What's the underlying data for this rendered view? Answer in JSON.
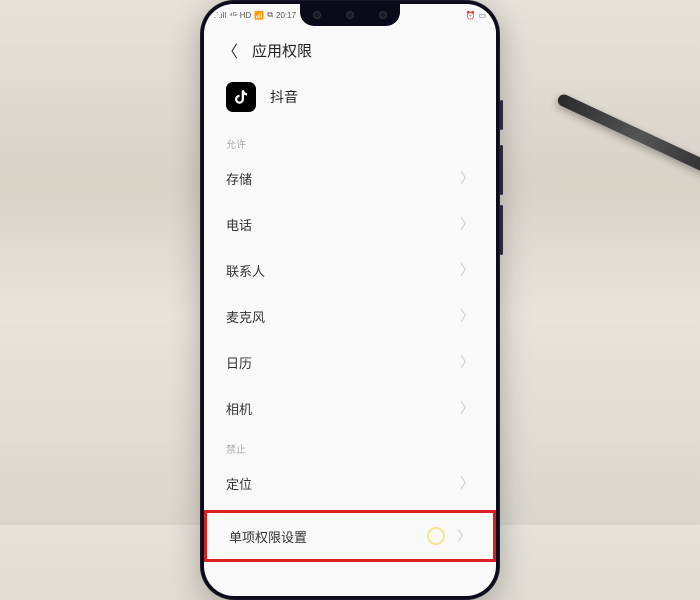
{
  "status": {
    "signal": "⁴ᴳ",
    "carrier": "⸫ıll",
    "hd": "HD",
    "wifi": "📶",
    "bt": "⧉",
    "time": "20:17",
    "alarm": "⏰",
    "battery": "▭"
  },
  "header": {
    "title": "应用权限"
  },
  "app": {
    "name": "抖音",
    "icon_glyph": "♪"
  },
  "sections": {
    "allow_label": "允许",
    "deny_label": "禁止"
  },
  "permissions_allow": {
    "storage": "存储",
    "phone": "电话",
    "contacts": "联系人",
    "microphone": "麦克风",
    "calendar": "日历",
    "camera": "相机"
  },
  "permissions_deny": {
    "location": "定位"
  },
  "footer": {
    "single_perm_settings": "单项权限设置"
  }
}
